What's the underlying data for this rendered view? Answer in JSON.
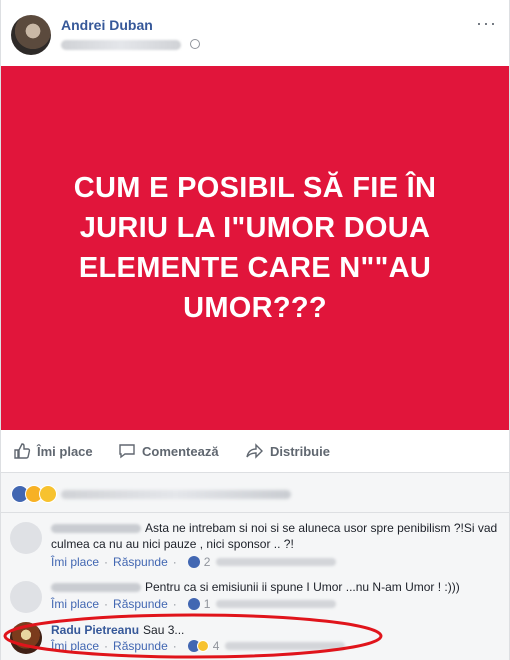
{
  "post": {
    "author": "Andrei Duban",
    "banner_text": "CUM E POSIBIL SĂ FIE ÎN JURIU LA I\"UMOR DOUA ELEMENTE CARE N\"\"AU UMOR???",
    "banner_color": "#e1153b",
    "icons": {
      "more": "ellipsis-icon",
      "privacy": "globe-icon"
    }
  },
  "actions": {
    "like": "Îmi place",
    "comment": "Comentează",
    "share": "Distribuie"
  },
  "comments": [
    {
      "text": "Asta ne intrebam si noi si se aluneca usor spre penibilism ?!Si vad culmea ca nu au nici pauze , nici sponsor .. ?!",
      "like_label": "Îmi place",
      "reply_label": "Răspunde",
      "reaction_count": "2"
    },
    {
      "text": "Pentru ca si emisiunii ii spune I Umor ...nu N-am Umor ! :)))",
      "like_label": "Îmi place",
      "reply_label": "Răspunde",
      "reaction_count": "1"
    },
    {
      "author": "Radu Pietreanu",
      "text": "Sau 3...",
      "like_label": "Îmi place",
      "reply_label": "Răspunde",
      "reaction_count": "4",
      "highlight_color": "#e0141b"
    }
  ]
}
